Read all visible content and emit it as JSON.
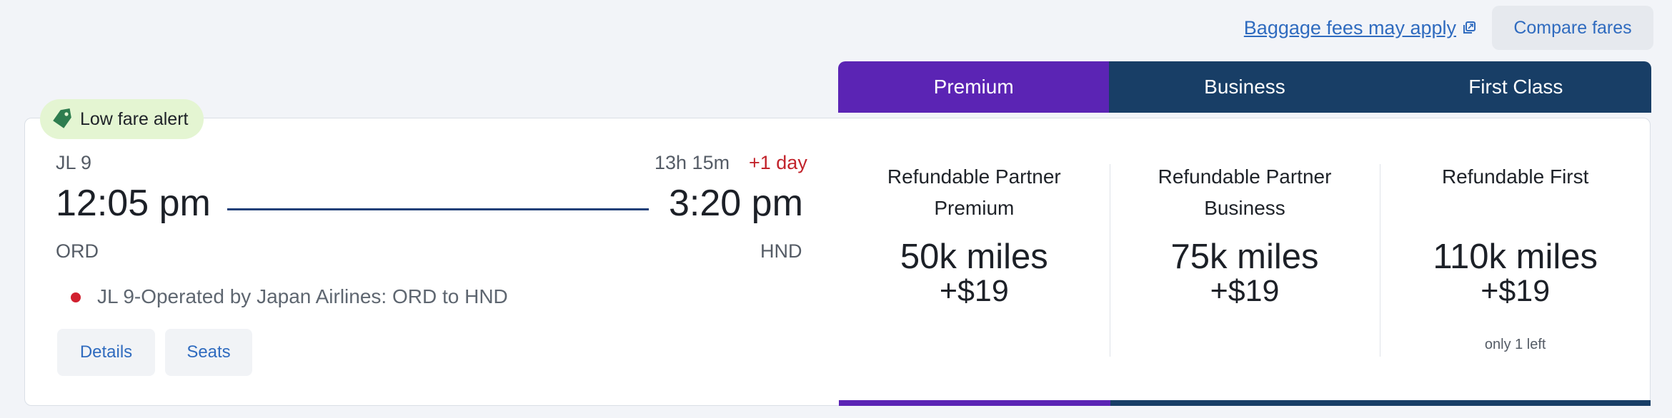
{
  "header": {
    "baggage_link": "Baggage fees may apply",
    "compare_button": "Compare fares"
  },
  "fare_tabs": [
    {
      "label": "Premium",
      "color": "#5b24b4"
    },
    {
      "label": "Business",
      "color": "#183e66"
    },
    {
      "label": "First Class",
      "color": "#183e66"
    }
  ],
  "alert": {
    "label": "Low fare alert",
    "icon": "price-tag-icon",
    "color": "#e4f5d2"
  },
  "flight": {
    "number": "JL 9",
    "duration": "13h 15m",
    "day_offset": "+1 day",
    "departure_time": "12:05 pm",
    "arrival_time": "3:20 pm",
    "origin": "ORD",
    "destination": "HND",
    "operated_by": "JL 9-Operated by Japan Airlines: ORD to HND",
    "airline_icon": "japan-airlines-logo-icon"
  },
  "actions": {
    "details": "Details",
    "seats": "Seats"
  },
  "fares": [
    {
      "name": "Refundable Partner Premium",
      "miles": "50k miles",
      "fee": "+$19",
      "availability": ""
    },
    {
      "name": "Refundable Partner Business",
      "miles": "75k miles",
      "fee": "+$19",
      "availability": ""
    },
    {
      "name": "Refundable First",
      "miles": "110k miles",
      "fee": "+$19",
      "availability": "only 1 left"
    }
  ],
  "colors": {
    "accent_purple": "#5b24b4",
    "accent_navy": "#183e66",
    "link_blue": "#2f6bbf",
    "alert_red": "#c2232b"
  }
}
